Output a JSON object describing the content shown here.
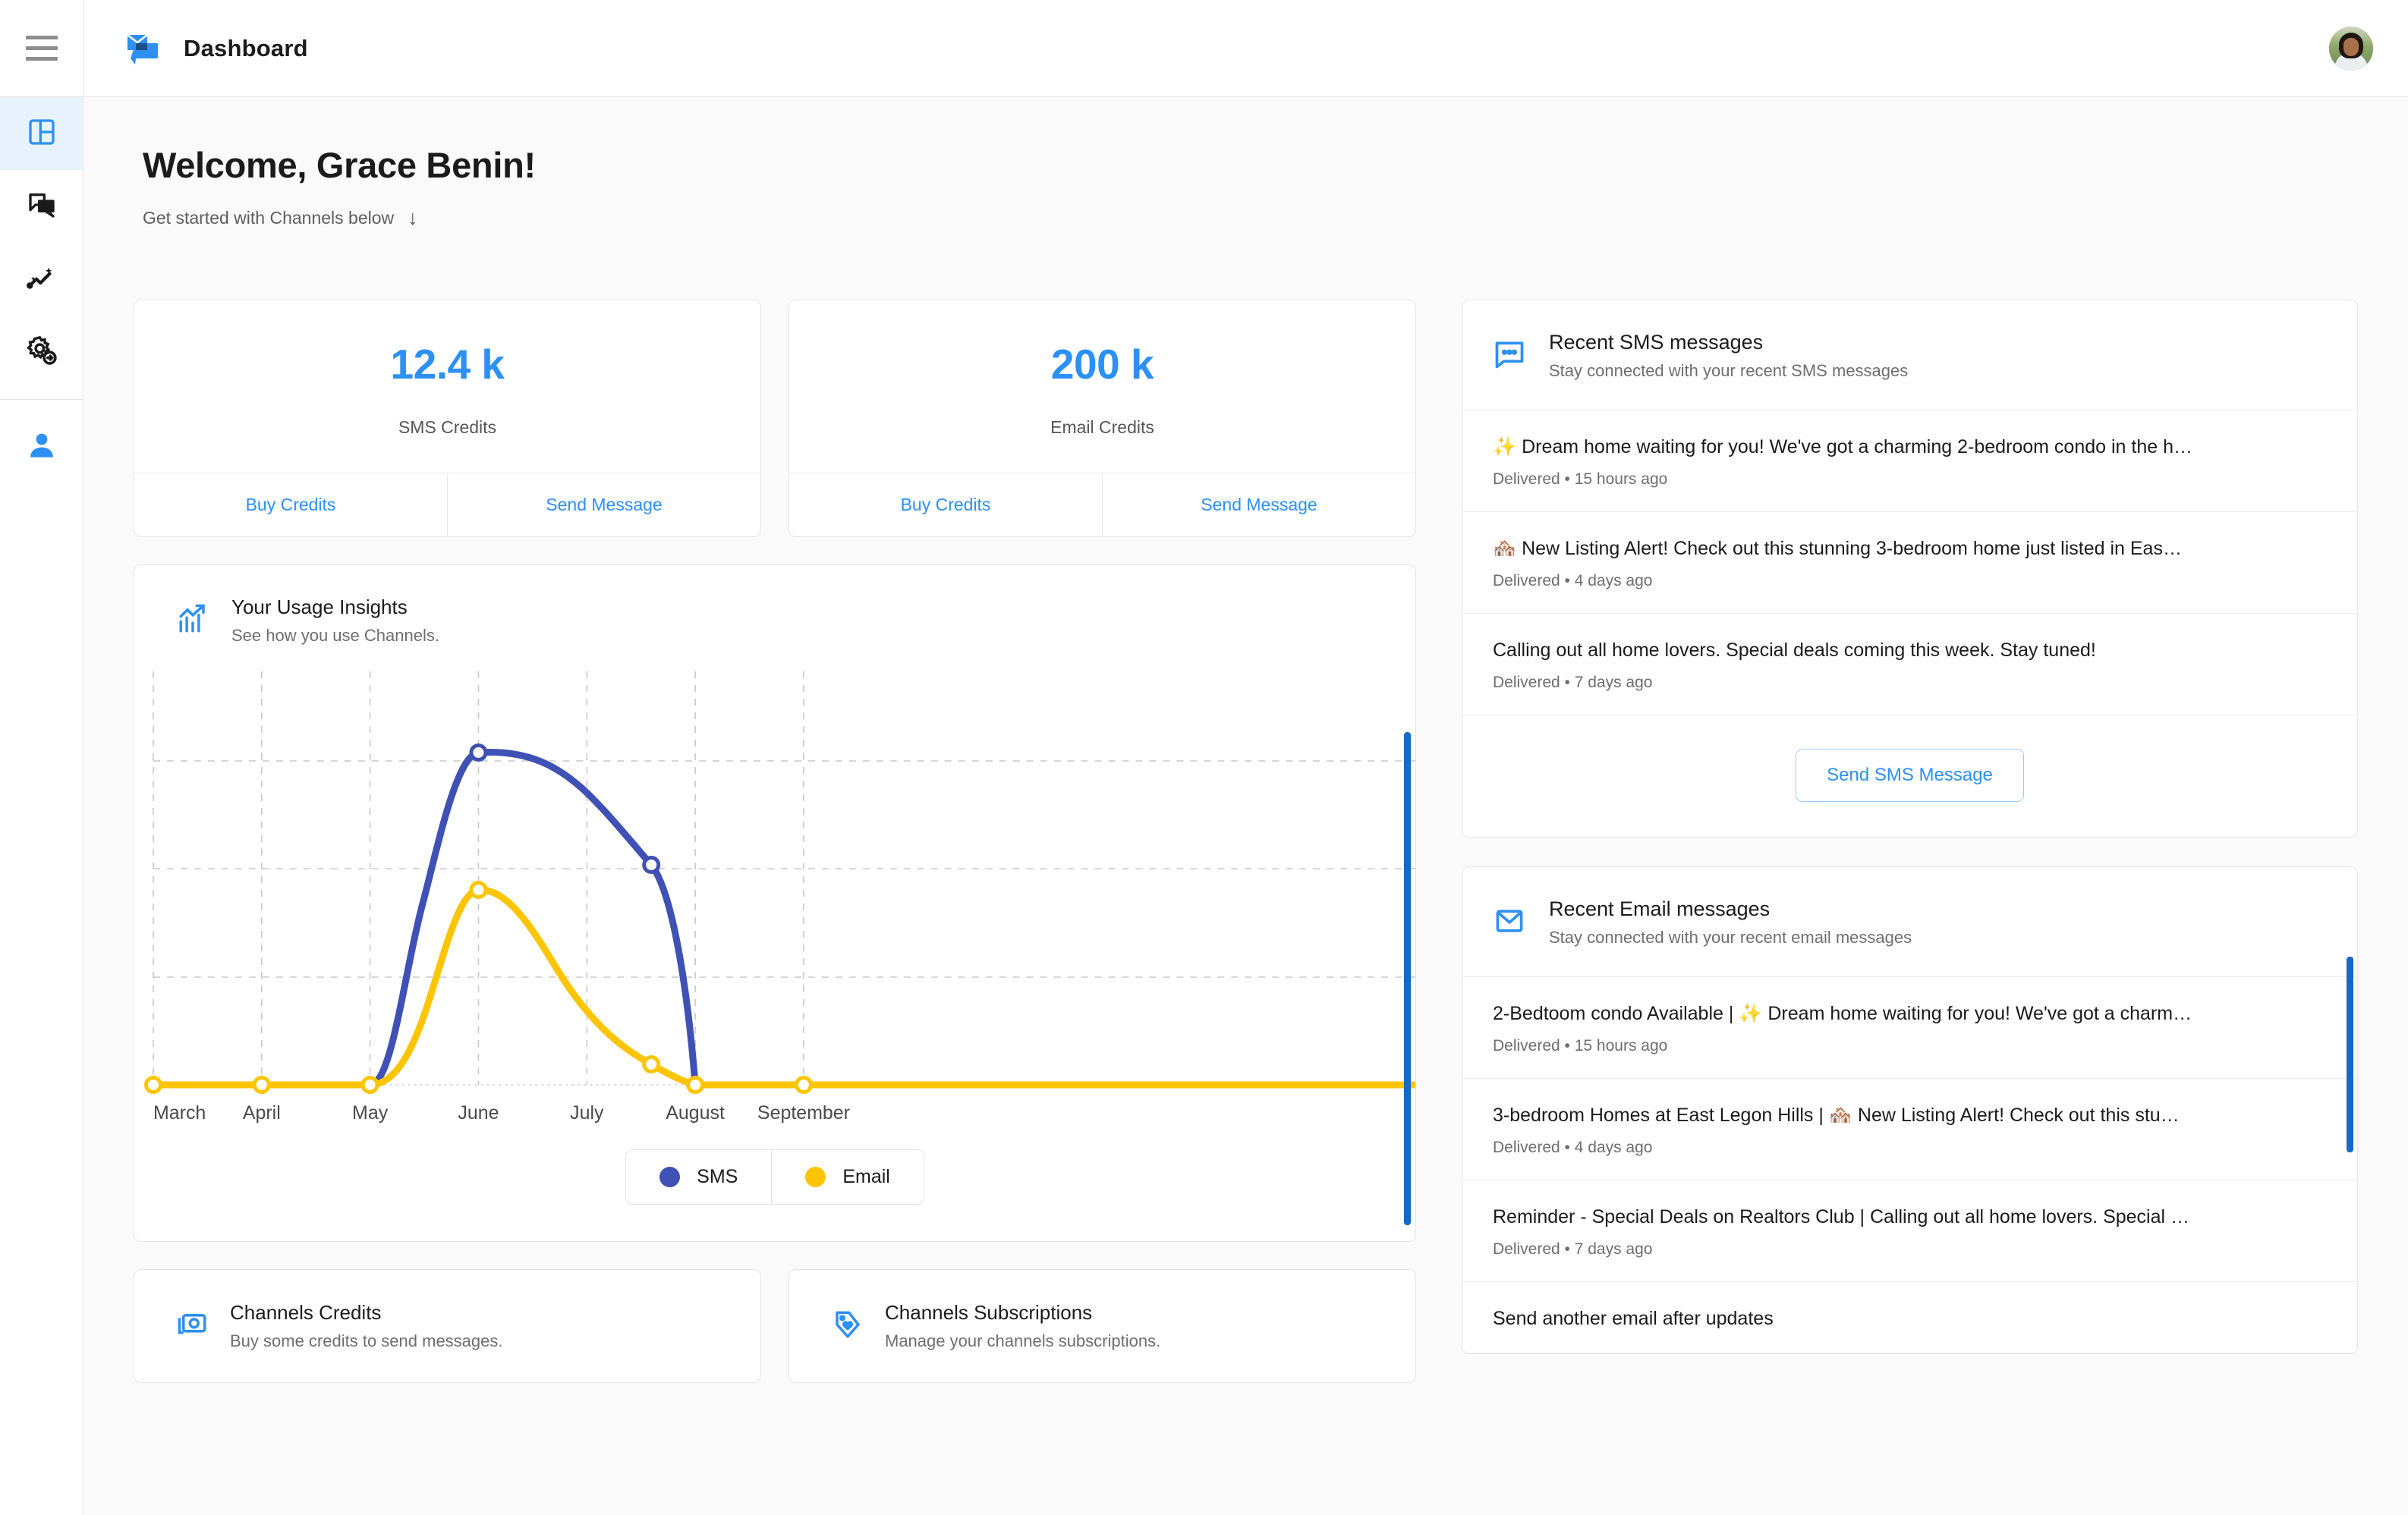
{
  "topbar": {
    "menu_icon": "hamburger-icon",
    "logo_icon": "channels-envelope-chat-logo",
    "title": "Dashboard",
    "avatar_icon": "user-avatar-photo"
  },
  "sidebar": {
    "items": [
      {
        "icon": "dashboard-layout-icon",
        "name": "dashboard",
        "active": true
      },
      {
        "icon": "chat-bubbles-icon",
        "name": "messages",
        "active": false
      },
      {
        "icon": "analytics-sparkle-icon",
        "name": "insights",
        "active": false
      },
      {
        "icon": "gear-arrow-icon",
        "name": "settings",
        "active": false
      },
      {
        "icon": "user-profile-icon",
        "name": "profile",
        "active": false
      }
    ]
  },
  "main": {
    "welcome": "Welcome, Grace Benin!",
    "subtitle": "Get started with Channels below",
    "subtitle_arrow": "↓"
  },
  "credits": [
    {
      "value": "12.4 k",
      "label": "SMS Credits",
      "buy_label": "Buy Credits",
      "send_label": "Send Message"
    },
    {
      "value": "200 k",
      "label": "Email Credits",
      "buy_label": "Buy Credits",
      "send_label": "Send Message"
    }
  ],
  "usage_card": {
    "icon": "bar-chart-trend-icon",
    "title": "Your Usage Insights",
    "subtitle": "See how you use Channels."
  },
  "chart_data": {
    "type": "line",
    "title": "Your Usage Insights",
    "xlabel": "",
    "ylabel": "",
    "grid": true,
    "legend_position": "bottom",
    "categories": [
      "March",
      "April",
      "May",
      "June",
      "July",
      "August",
      "September"
    ],
    "ylim": [
      0,
      100
    ],
    "series": [
      {
        "name": "SMS",
        "color": "#3f51b5",
        "values": [
          0,
          0,
          0,
          88,
          62,
          0,
          0
        ]
      },
      {
        "name": "Email",
        "color": "#fdc500",
        "values": [
          0,
          0,
          0,
          52,
          16,
          0,
          0
        ]
      }
    ],
    "legend": [
      "SMS",
      "Email"
    ]
  },
  "bottom_cards": [
    {
      "icon": "cash-credits-icon",
      "title": "Channels Credits",
      "subtitle": "Buy some credits to send messages."
    },
    {
      "icon": "price-tag-icon",
      "title": "Channels Subscriptions",
      "subtitle": "Manage your channels subscriptions."
    }
  ],
  "sms_panel": {
    "icon": "sms-chat-icon",
    "title": "Recent SMS messages",
    "subtitle": "Stay connected with your recent SMS messages",
    "messages": [
      {
        "text": "✨ Dream home waiting for you! We've got a charming 2-bedroom condo in the h…",
        "meta": "Delivered • 15 hours ago"
      },
      {
        "text": "🏘️ New Listing Alert! Check out this stunning 3-bedroom home just listed in Eas…",
        "meta": "Delivered • 4 days ago"
      },
      {
        "text": "Calling out all home lovers. Special deals coming this week. Stay tuned!",
        "meta": "Delivered • 7 days ago"
      }
    ],
    "button_label": "Send SMS Message"
  },
  "email_panel": {
    "icon": "email-envelope-icon",
    "title": "Recent Email messages",
    "subtitle": "Stay connected with your recent email messages",
    "messages": [
      {
        "text": "2-Bedtoom condo Available | ✨ Dream home waiting for you! We've got a charm…",
        "meta": "Delivered • 15 hours ago"
      },
      {
        "text": "3-bedroom Homes at East Legon Hills | 🏘️ New Listing Alert! Check out this stu…",
        "meta": "Delivered • 4 days ago"
      },
      {
        "text": "Reminder - Special Deals on Realtors Club | Calling out all home lovers. Special …",
        "meta": "Delivered • 7 days ago"
      },
      {
        "text": "Send another email after updates",
        "meta": ""
      }
    ]
  },
  "colors": {
    "accent": "#2c90f4",
    "sms": "#3f51b5",
    "email": "#fdc500",
    "scrollbar": "#1769c4",
    "sidebar_active_bg": "#e8f2fd"
  }
}
